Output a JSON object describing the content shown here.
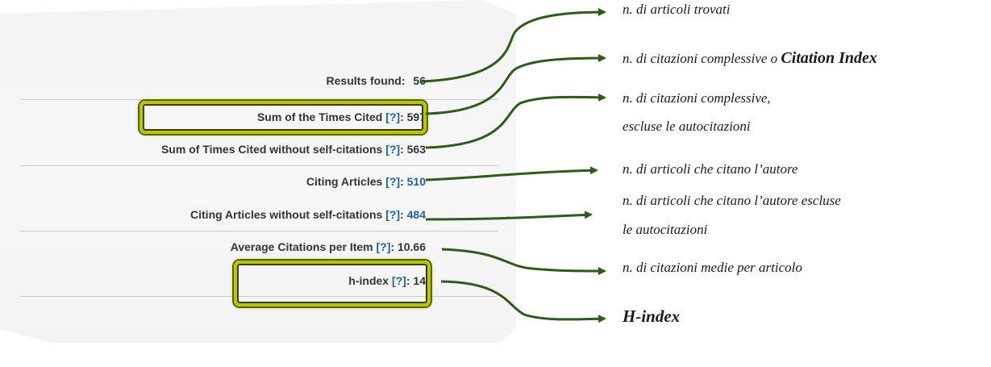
{
  "stats": [
    {
      "label": "Results found:",
      "help": "",
      "value": "56",
      "value_color": "dark"
    },
    {
      "label": "Sum of the Times Cited",
      "help": "[?]",
      "value": "597",
      "value_color": "dark"
    },
    {
      "label": "Sum of Times Cited without self-citations",
      "help": "[?]",
      "value": "563",
      "value_color": "dark"
    },
    {
      "label": "Citing Articles",
      "help": "[?]",
      "value": "510",
      "value_color": "blue"
    },
    {
      "label": "Citing Articles without self-citations",
      "help": "[?]",
      "value": "484",
      "value_color": "blue"
    },
    {
      "label": "Average Citations per Item",
      "help": "[?]",
      "value": "10.66",
      "value_color": "dark"
    },
    {
      "label": "h-index",
      "help": "[?]",
      "value": "14",
      "value_color": "dark"
    }
  ],
  "separator": ":",
  "annotations": {
    "a1": "n. di articoli trovati",
    "a2_prefix": "n. di citazioni complessive o ",
    "a2_bold": "Citation Index",
    "a3_line1": "n. di citazioni complessive,",
    "a3_line2": "escluse le autocitazioni",
    "a4": "n. di articoli che citano l’autore",
    "a5_line1": "n. di articoli che citano l’autore escluse",
    "a5_line2": "le autocitazioni",
    "a6": "n. di citazioni medie per articolo",
    "a7": "H-index"
  },
  "colors": {
    "highlight": "#b5c41a",
    "arrow": "#2f5a1e",
    "link_blue": "#1f5fa0"
  }
}
